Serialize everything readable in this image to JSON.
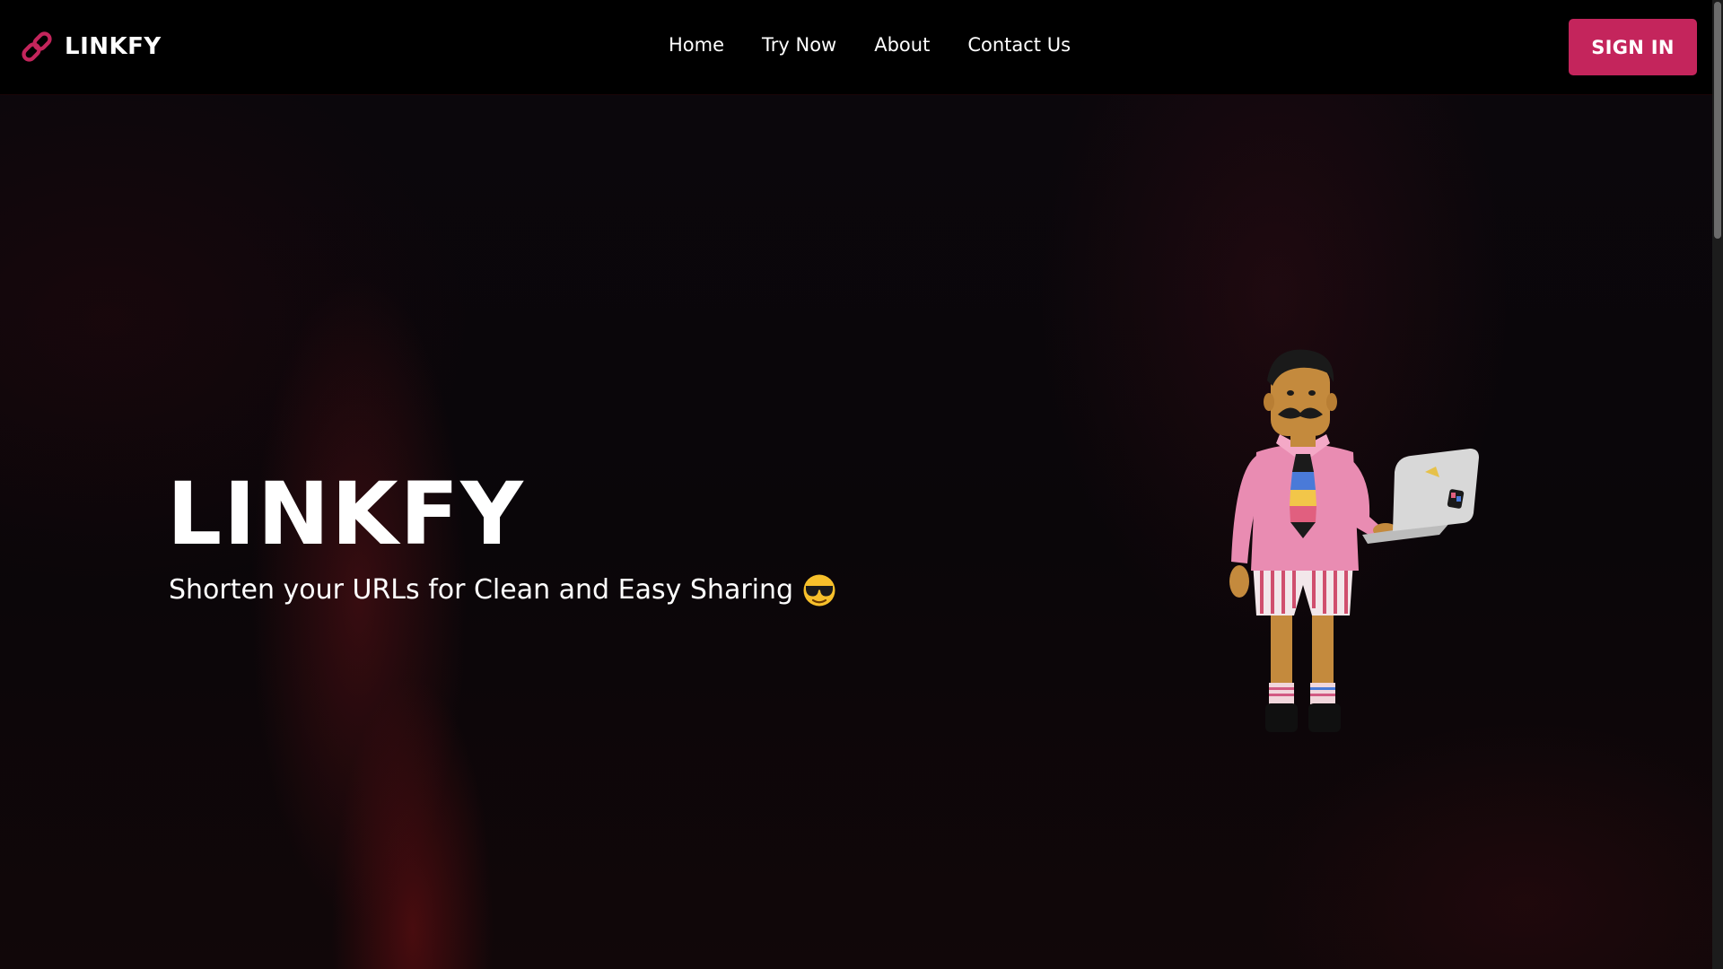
{
  "navbar": {
    "brand": "LINKFY",
    "links": [
      "Home",
      "Try Now",
      "About",
      "Contact Us"
    ],
    "signin_label": "SIGN IN"
  },
  "hero": {
    "title": "LINKFY",
    "subtitle": "Shorten your URLs for Clean and Easy Sharing"
  },
  "icons": {
    "brand": "link-icon",
    "subtitle": "sunglasses-emoji-icon",
    "illustration": "man-with-laptop-illustration"
  },
  "colors": {
    "accent": "#c4255c",
    "navbar_background": "#000000",
    "hero_background": "#0a0609",
    "text": "#ffffff"
  }
}
